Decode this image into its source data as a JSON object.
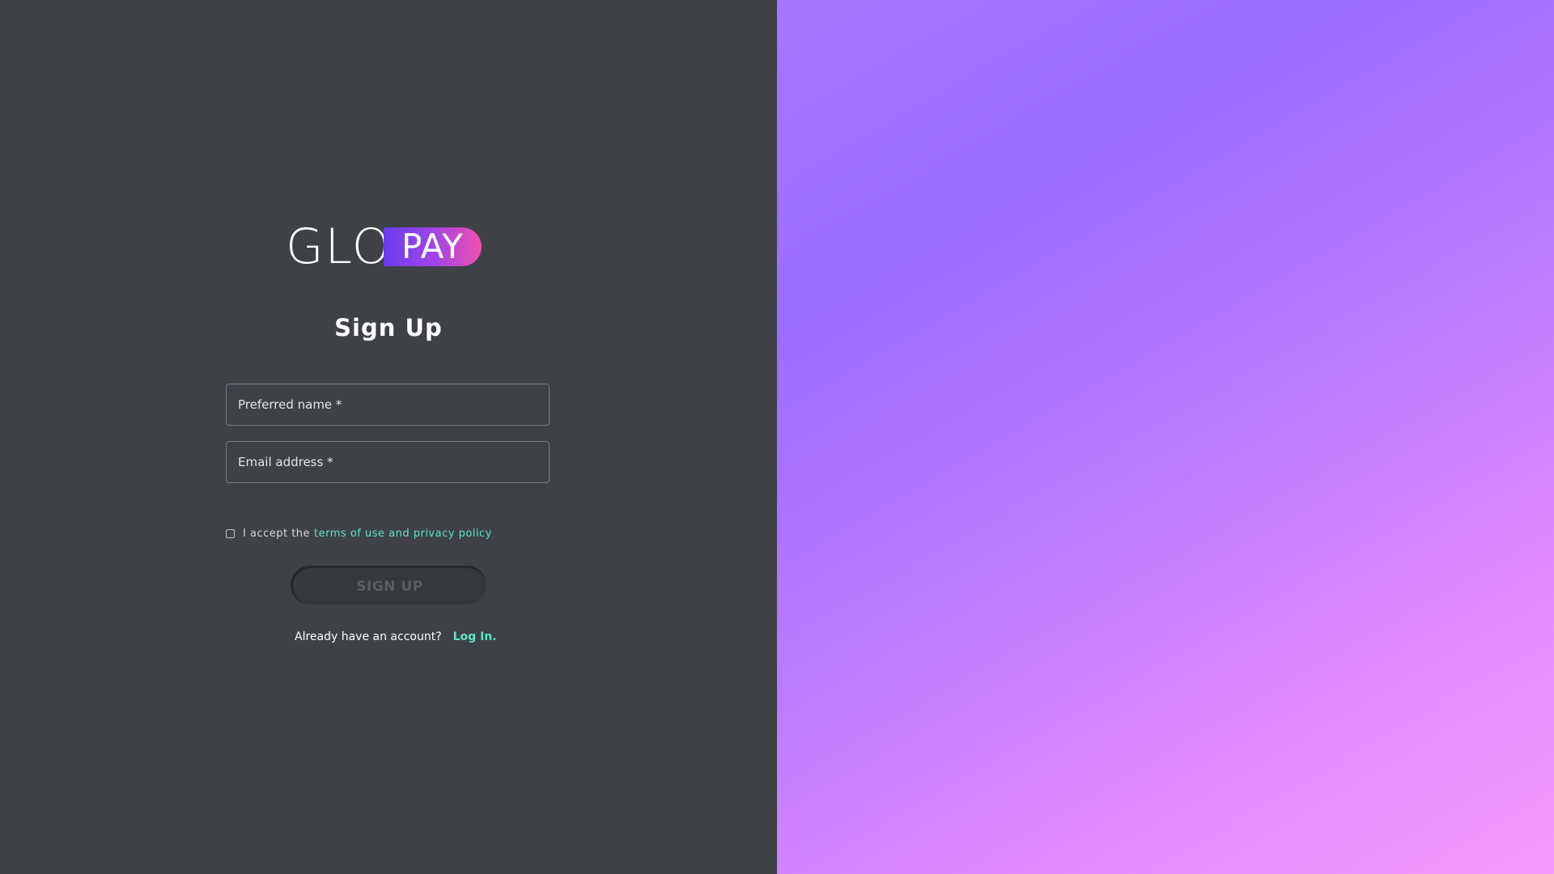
{
  "brand": {
    "logo_part1": "GLO",
    "logo_part2": "PAY"
  },
  "form": {
    "title": "Sign Up",
    "name_placeholder": "Preferred name *",
    "email_placeholder": "Email address *",
    "terms_prefix": "I accept the",
    "terms_link": "terms of use and privacy policy",
    "terms_checked": false,
    "submit_label": "SIGN UP",
    "login_prompt": "Already have an account?",
    "login_link": "Log In."
  },
  "colors": {
    "panel_background": "#3e4146",
    "accent": "#5fe3c6",
    "gradient_start": "#9a6cff",
    "gradient_end": "#f799ff"
  }
}
